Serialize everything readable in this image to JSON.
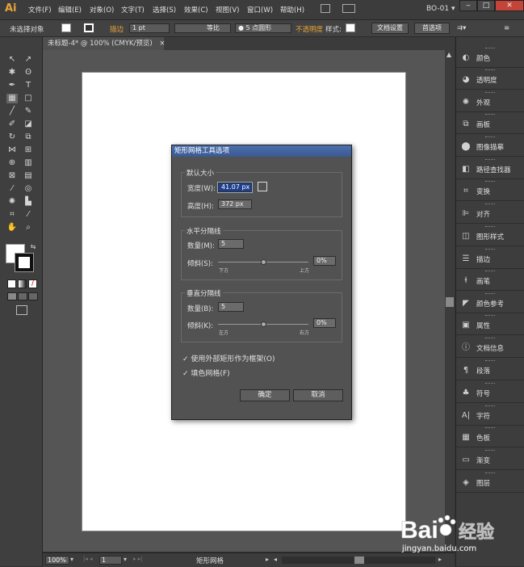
{
  "app": {
    "logo": "Ai",
    "workspace": "BO-01",
    "workspace_caret": "▾"
  },
  "menu": [
    "文件(F)",
    "编辑(E)",
    "对象(O)",
    "文字(T)",
    "选择(S)",
    "效果(C)",
    "视图(V)",
    "窗口(W)",
    "帮助(H)"
  ],
  "window_controls": {
    "min": "‒",
    "max": "□",
    "close": "✕"
  },
  "control_bar": {
    "selection": "未选择对象",
    "stroke_label": "描边",
    "stroke_weight": "1 pt",
    "profile": "等比",
    "brush": "● 5 点圆形",
    "opacity_label": "不透明度",
    "style_label": "样式:",
    "doc_setup": "文档设置",
    "preferences": "首选项"
  },
  "document_tab": {
    "title": "未标题-4* @ 100% (CMYK/预览)",
    "close": "×"
  },
  "status_bar": {
    "zoom": "100%",
    "page": "1",
    "tool": "矩形网格"
  },
  "panels": [
    "颜色",
    "透明度",
    "外观",
    "画板",
    "图像描摹",
    "路径查找器",
    "变换",
    "对齐",
    "图形样式",
    "描边",
    "画笔",
    "颜色参考",
    "属性",
    "文档信息",
    "段落",
    "符号",
    "字符",
    "色板",
    "渐变",
    "图层"
  ],
  "panel_icons": [
    "color-icon",
    "transparency-icon",
    "appearance-icon",
    "artboards-icon",
    "image-trace-icon",
    "pathfinder-icon",
    "transform-icon",
    "align-icon",
    "graphic-styles-icon",
    "stroke-icon",
    "brushes-icon",
    "color-guide-icon",
    "attributes-icon",
    "document-info-icon",
    "paragraph-icon",
    "symbols-icon",
    "character-icon",
    "swatches-icon",
    "gradient-icon",
    "layers-icon"
  ],
  "dialog": {
    "title": "矩形网格工具选项",
    "default_size": {
      "label": "默认大小",
      "width_label": "宽度(W):",
      "width_value": "41.07 px",
      "height_label": "高度(H):",
      "height_value": "372 px"
    },
    "horizontal": {
      "label": "水平分隔线",
      "count_label": "数量(M):",
      "count_value": "5",
      "skew_label": "倾斜(S):",
      "skew_value": "0%",
      "min_label": "下方",
      "max_label": "上方"
    },
    "vertical": {
      "label": "垂直分隔线",
      "count_label": "数量(B):",
      "count_value": "5",
      "skew_label": "倾斜(K):",
      "skew_value": "0%",
      "min_label": "左方",
      "max_label": "右方"
    },
    "use_outer_rect": "使用外部矩形作为框架(O)",
    "fill_grid": "填色网格(F)",
    "check_mark": "✓",
    "ok": "确定",
    "cancel": "取消"
  },
  "watermark": {
    "brand": "Bai",
    "brand2": "经验",
    "url": "jingyan.baidu.com"
  }
}
